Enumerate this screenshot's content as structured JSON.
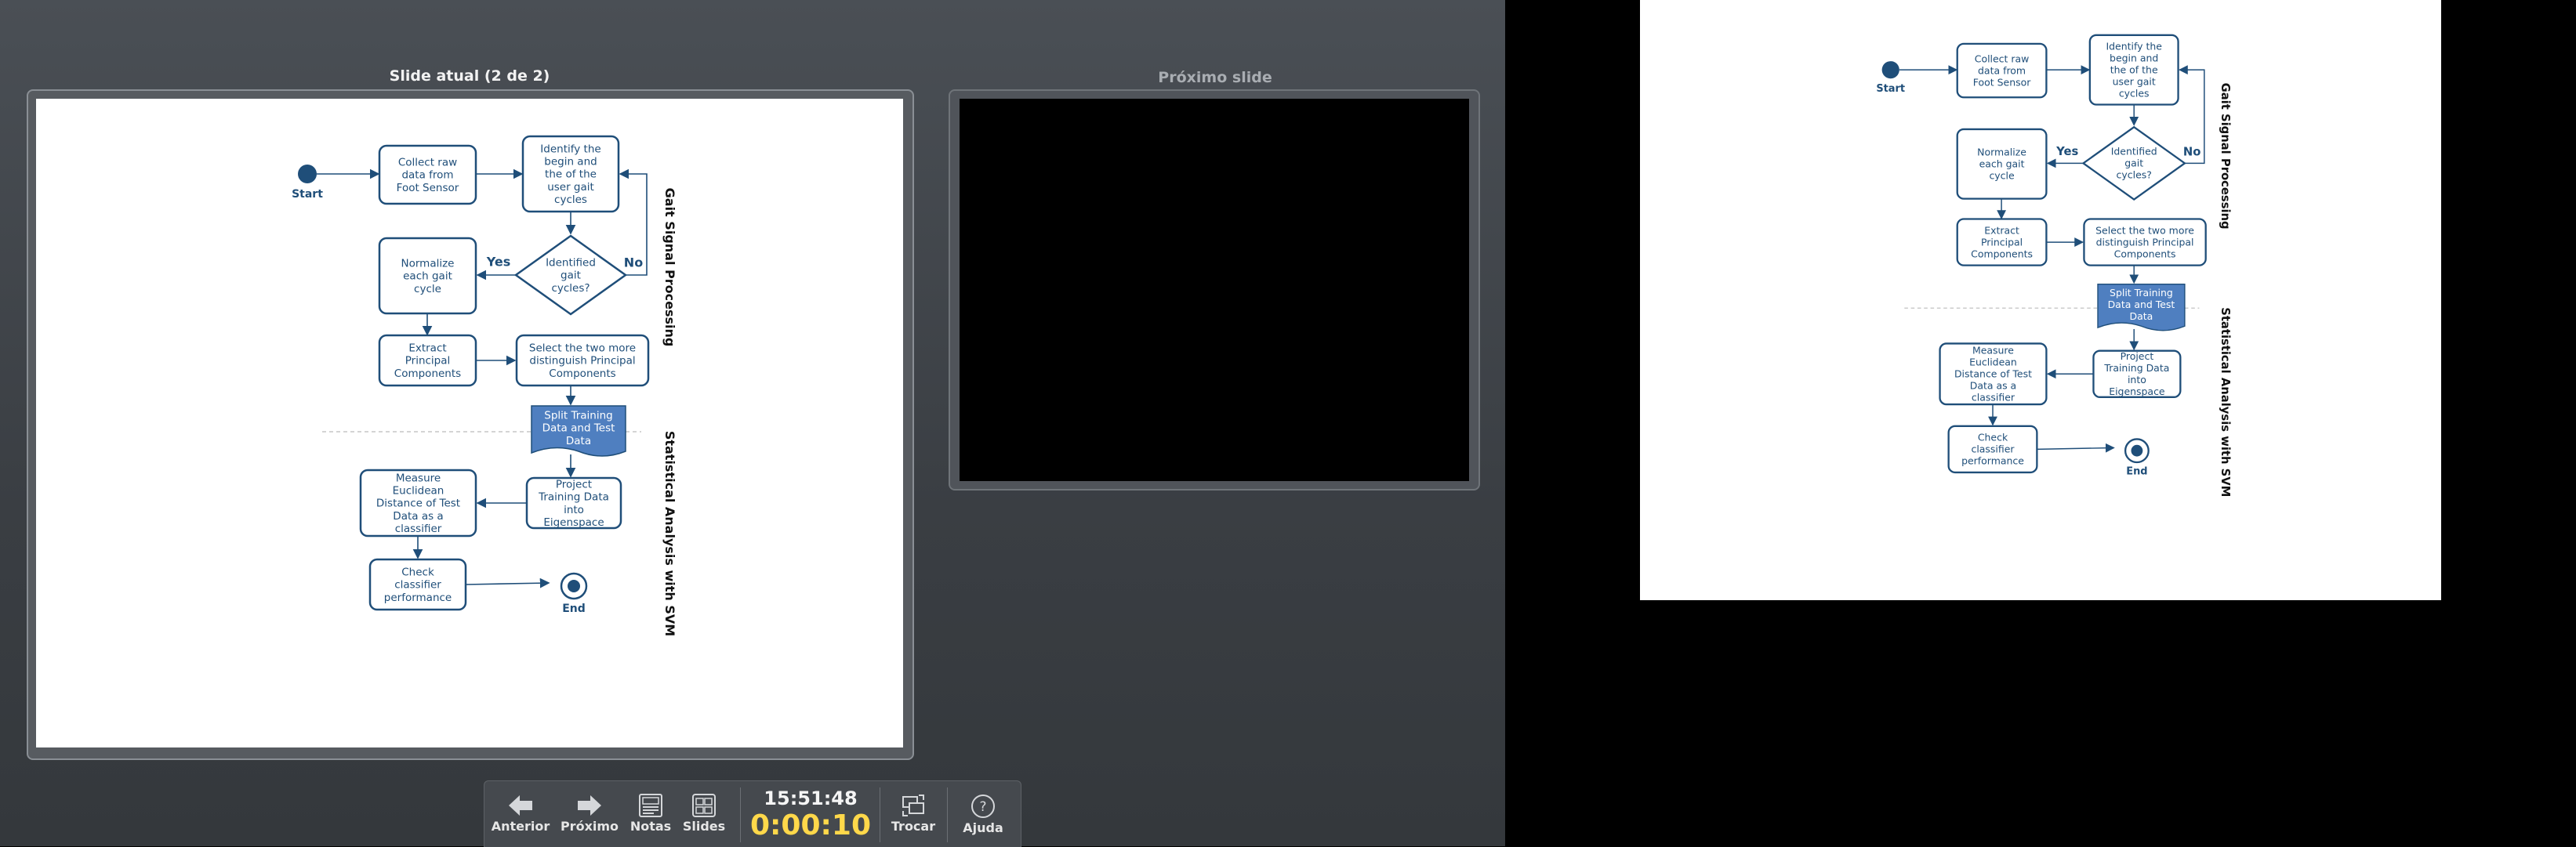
{
  "presenter": {
    "current_title": "Slide atual (2 de 2)",
    "next_title": "Próximo slide",
    "clock": "15:51:48",
    "timer": "0:00:10",
    "toolbar": {
      "previous": "Anterior",
      "next": "Próximo",
      "notes": "Notas",
      "slides": "Slides",
      "swap": "Trocar",
      "help": "Ajuda"
    }
  },
  "slide": {
    "start": "Start",
    "end": "End",
    "collect": [
      "Collect raw",
      "data from",
      "Foot Sensor"
    ],
    "identify": [
      "Identify the",
      "begin and",
      "the of the",
      "user gait",
      "cycles"
    ],
    "decision": [
      "Identified",
      "gait",
      "cycles?"
    ],
    "yes": "Yes",
    "no": "No",
    "normalize": [
      "Normalize",
      "each gait",
      "cycle"
    ],
    "extract": [
      "Extract",
      "Principal",
      "Components"
    ],
    "select": [
      "Select the two more",
      "distinguish Principal",
      "Components"
    ],
    "split": [
      "Split Training",
      "Data and Test",
      "Data"
    ],
    "project": [
      "Project",
      "Training Data",
      "into",
      "Eigenspace"
    ],
    "measure": [
      "Measure",
      "Euclidean",
      "Distance of Test",
      "Data as a",
      "classifier"
    ],
    "check": [
      "Check",
      "classifier",
      "performance"
    ],
    "section1": "Gait Signal Processing",
    "section2": "Statistical Analysis with SVM"
  },
  "colors": {
    "node_stroke": "#1f4e79",
    "node_text": "#1f4e79",
    "split_fill": "#4f7fc0",
    "clock": "#ffd84a"
  }
}
